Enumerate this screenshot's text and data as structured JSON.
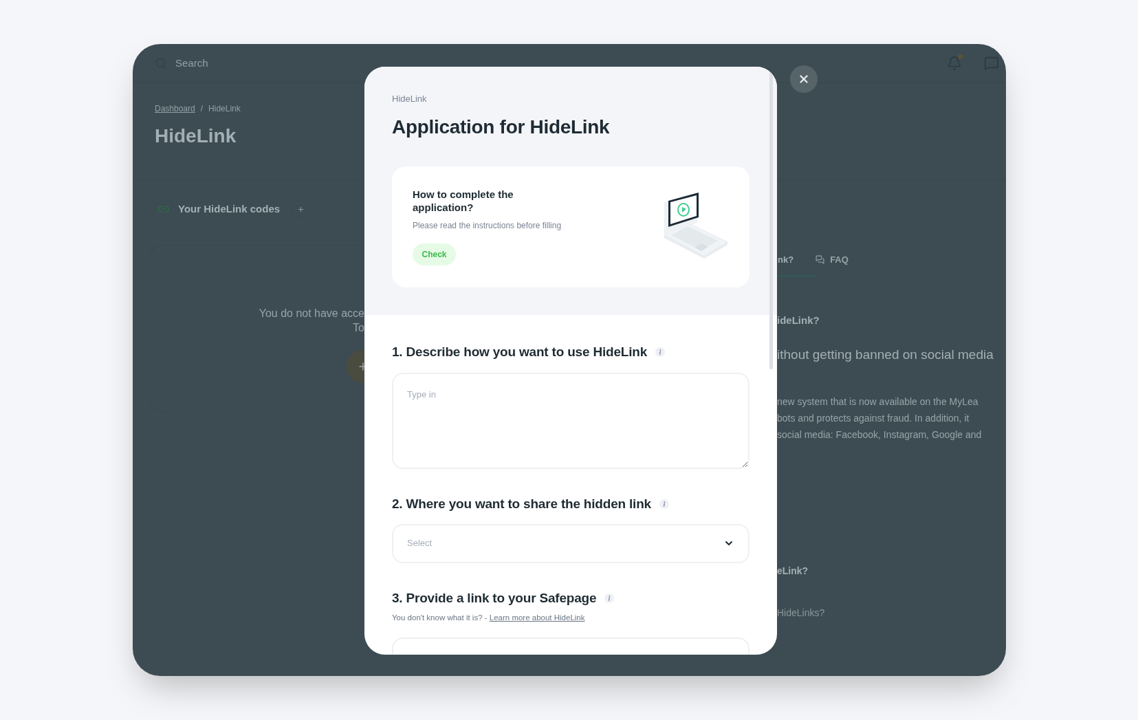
{
  "background": {
    "search": {
      "placeholder": "Search"
    },
    "notifications": {
      "unread": true
    },
    "breadcrumb": [
      {
        "label": "Dashboard",
        "kind": "link"
      },
      {
        "label": "HideLink",
        "kind": "current"
      }
    ],
    "breadcrumb_separator": "/",
    "page_title": "HideLink",
    "codes_panel": {
      "title": "Your HideLink codes",
      "empty_text": [
        "You do not have acce",
        "To"
      ]
    },
    "tabs": [
      {
        "label": "nk?",
        "selected": true
      },
      {
        "label": "FAQ",
        "selected": false
      }
    ],
    "article": {
      "question": "ideLink?",
      "headline": "ithout getting banned on social media",
      "paragraph": [
        "new system that is now available on the MyLea",
        "bots and protects against fraud. In addition, it",
        "social media: Facebook, Instagram, Google and"
      ],
      "more_questions": [
        "eLink?",
        "HideLinks?"
      ]
    }
  },
  "modal": {
    "breadcrumb": "HideLink",
    "title": "Application for HideLink",
    "instructions": {
      "title": "How to complete the application?",
      "subtitle": "Please read the instructions before filling",
      "button": "Check"
    },
    "questions": [
      {
        "kind": "textarea",
        "label": "1. Describe how you want to use HideLink",
        "placeholder": "Type in"
      },
      {
        "kind": "select",
        "label": "2. Where you want to share the hidden link",
        "placeholder": "Select"
      },
      {
        "kind": "input",
        "label": "3. Provide a link to your Safepage",
        "hint": "You don't know what it is? -",
        "hint_link": "Learn more about HideLink"
      }
    ]
  }
}
